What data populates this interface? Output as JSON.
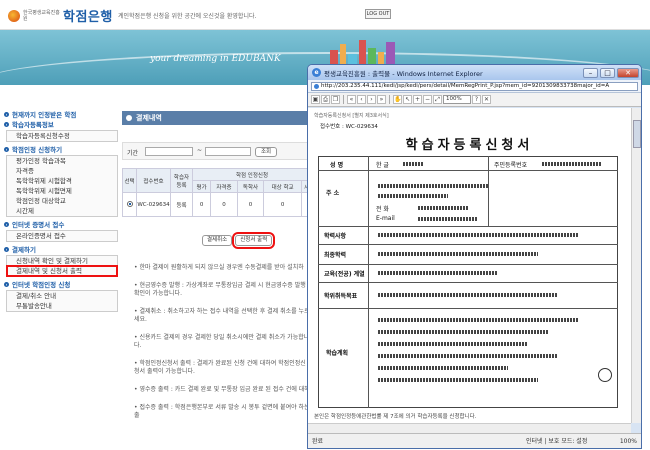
{
  "header": {
    "logo_small": "한국평생교육진흥원",
    "logo_title": "학점은행",
    "welcome": "계인학점은행 신청을 위한 공간에 오신것을 환영합니다.",
    "logout": "LOG OUT"
  },
  "banner": {
    "slogan": "your dreaming  in  EDUBANK"
  },
  "sidebar": {
    "groups": [
      {
        "title": "현재까지 인정받은 학점",
        "items": []
      },
      {
        "title": "학습자등록정보",
        "items": [
          "학습자등록신청수정"
        ],
        "boxed": true
      },
      {
        "title": "학점인정 신청하기",
        "items": [
          "평가인정 학습과목",
          "자격증",
          "독학학위제 시험합격",
          "독학학위제 시험면제",
          "학점인정 대상학교",
          "시간제"
        ],
        "boxed": true
      },
      {
        "title": "인터넷 증명서 접수",
        "items": [
          "온라인증명서 접수"
        ],
        "boxed": true
      },
      {
        "title": "결제하기",
        "items": [
          "신청내역 확인 및 결제하기",
          "결제내역 및 신청서 출력"
        ],
        "boxed": true
      },
      {
        "title": "인터넷 학점인정 신청",
        "items": [
          "결제/취소 안내",
          "무통발송안내"
        ],
        "boxed": true
      }
    ]
  },
  "content": {
    "heading": "결제내역",
    "period_label": "기간",
    "search_button": "조회",
    "table": {
      "headers": [
        "선택",
        "접수번호",
        "학습자 등록",
        "학점 인정신청"
      ],
      "sub_headers": [
        "평가",
        "자격증",
        "독학사",
        "대상 학교",
        "시"
      ],
      "row": [
        "",
        "WC-029634",
        "등록",
        "0",
        "0",
        "0",
        "0",
        ""
      ]
    },
    "cancel_button": "결제취소",
    "print_button": "신청서 출력",
    "notes": [
      "• 한마 결제이 원활하게 되지 않으실 경우엔 수동결제를 받아 설치하",
      "• 현금영수증 발행 : 가상계좌로 무통장입금 결제 시 현금영수증 발행 확인이 가능합니다.",
      "• 결제취소 : 취소하고자 하는 접수 내역을 선택한 후 결제 취소를 누르세요.",
      "• 신용카드 결제의 경우 결제한 당일 취소시에만 결제 취소가 가능합니다.",
      "• 학점인정신청서 출력 : 결제가 완료된 신청 건에 대하여 학점인정신청서 출력이 가능합니다.",
      "• 영수증 출력 : 카드 결제 완료 및 무통장 입금 완료 된 접수 건에 대해",
      "• 접수증 출력 : 학점은행본부로 서류 발송 시 봉투 겉면에 붙여야 하는 출"
    ]
  },
  "popup": {
    "title": "평생교육진흥원 : 출력물 - Windows Internet Explorer",
    "url": "http://203.235.44.111/kedi/jsp/kedi/pers/detail/MemRegPrint_P.jsp?mem_id=9201309833738major_id=A",
    "zoom": "100%",
    "doc": {
      "header_note": "학습자등록신청서 [별지 제3호서식]",
      "receipt_label": "접수번호 : WC-029634",
      "title": "학습자등록신청서",
      "fields": {
        "name_label": "성   명",
        "name_hanja": "한 글",
        "reg_no_label": "주민등록번호",
        "addr_label": "주   소",
        "phone_label": "전   화",
        "email_label": "E-mail",
        "edu_label": "학력사항",
        "highest_label": "최종학력",
        "career_label": "교육(전공) 계열",
        "goal_label": "학위취득목표",
        "plan_label": "학습계획"
      },
      "footer": "본인은 학점인정등에관한법률 제 7조에 의거 학습자등록을 신청합니다."
    },
    "status_left": "완료",
    "status_zone": "인터넷 | 보호 모드: 설정",
    "status_zoom": "100%"
  }
}
